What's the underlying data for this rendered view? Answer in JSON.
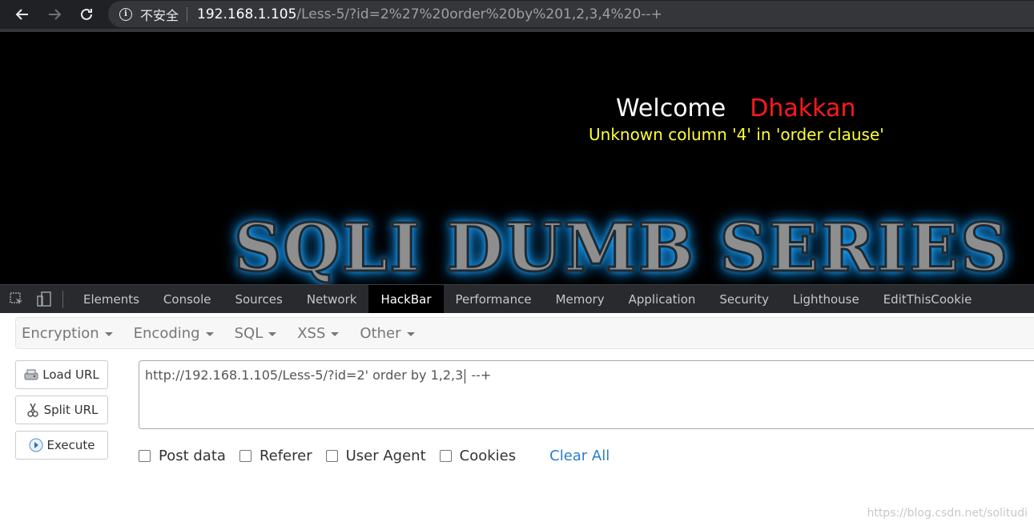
{
  "browser": {
    "insecure_label": "不安全",
    "url_host": "192.168.1.105",
    "url_path": "/Less-5/?id=2%27%20order%20by%201,2,3,4%20--+"
  },
  "page": {
    "welcome": "Welcome",
    "username": "Dhakkan",
    "error": "Unknown column '4' in 'order clause'",
    "banner": "SQLI DUMB SERIES",
    "colors": {
      "welcome": "#ffffff",
      "username": "#ff1a1a",
      "error": "#ffff33",
      "banner_glow": "#1aa3ff"
    }
  },
  "devtools": {
    "tabs": [
      {
        "label": "Elements"
      },
      {
        "label": "Console"
      },
      {
        "label": "Sources"
      },
      {
        "label": "Network"
      },
      {
        "label": "HackBar",
        "active": true
      },
      {
        "label": "Performance"
      },
      {
        "label": "Memory"
      },
      {
        "label": "Application"
      },
      {
        "label": "Security"
      },
      {
        "label": "Lighthouse"
      },
      {
        "label": "EditThisCookie"
      }
    ]
  },
  "hackbar": {
    "menus": [
      "Encryption",
      "Encoding",
      "SQL",
      "XSS",
      "Other"
    ],
    "buttons": {
      "load": "Load URL",
      "split": "Split URL",
      "execute": "Execute"
    },
    "url_before_cursor": "http://192.168.1.105/Less-5/?id=2' order by 1,2,3",
    "url_after_cursor": " --+",
    "options": {
      "post": "Post data",
      "referer": "Referer",
      "user_agent": "User Agent",
      "cookies": "Cookies"
    },
    "clear_all": "Clear All"
  },
  "watermark": "https://blog.csdn.net/solitudi"
}
